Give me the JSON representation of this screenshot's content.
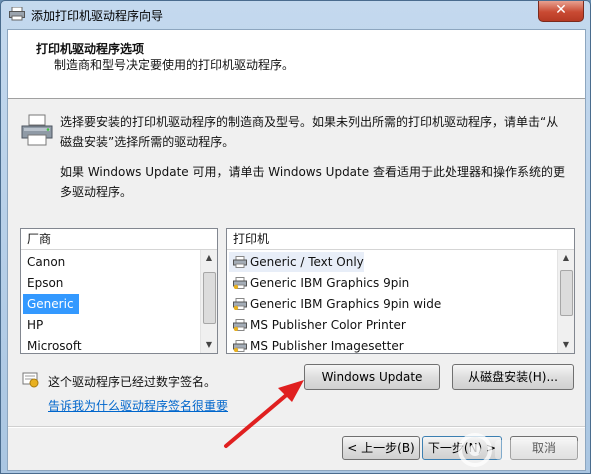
{
  "window": {
    "title": "添加打印机驱动程序向导",
    "close_label": "✕"
  },
  "header": {
    "title": "打印机驱动程序选项",
    "subtitle": "制造商和型号决定要使用的打印机驱动程序。"
  },
  "description": {
    "line1": "选择要安装的打印机驱动程序的制造商及型号。如果未列出所需的打印机驱动程序，请单击“从磁盘安装”选择所需的驱动程序。",
    "line2": "如果 Windows Update 可用，请单击 Windows Update 查看适用于此处理器和操作系统的更多驱动程序。"
  },
  "manufacturer_list": {
    "header": "厂商",
    "items": [
      "Canon",
      "Epson",
      "Generic",
      "HP",
      "Microsoft"
    ],
    "selected": "Generic"
  },
  "printer_list": {
    "header": "打印机",
    "items": [
      "Generic / Text Only",
      "Generic IBM Graphics 9pin",
      "Generic IBM Graphics 9pin wide",
      "MS Publisher Color Printer",
      "MS Publisher Imagesetter"
    ]
  },
  "buttons": {
    "windows_update": "Windows Update",
    "have_disk": "从磁盘安装(H)...",
    "back": "< 上一步(B)",
    "next": "下一步(N) >",
    "cancel": "取消"
  },
  "signature": {
    "status": "这个驱动程序已经过数字签名。",
    "link": "告诉我为什么驱动程序签名很重要"
  },
  "colors": {
    "selection": "#3399ff",
    "link": "#0066cc",
    "arrow": "#e02020"
  }
}
